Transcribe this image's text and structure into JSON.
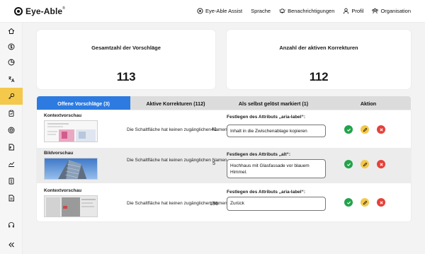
{
  "app": {
    "logo_text": "Eye-Able",
    "logo_mark": "®"
  },
  "topnav": [
    {
      "label": "Eye-Able Assist",
      "icon": "assist-icon"
    },
    {
      "label": "Sprache",
      "icon": ""
    },
    {
      "label": "Benachrichtigungen",
      "icon": "bell-icon"
    },
    {
      "label": "Profil",
      "icon": "user-icon"
    },
    {
      "label": "Organisation",
      "icon": "organisation-icon"
    }
  ],
  "sidebar": {
    "items": [
      "home-icon",
      "dollar-icon",
      "pie-chart-icon",
      "translate-icon",
      "key-icon",
      "clipboard-icon",
      "target-icon",
      "pdf-icon",
      "line-chart-icon",
      "report-icon",
      "document-icon"
    ],
    "active_index": 4,
    "bottom": [
      "support-icon",
      "collapse-icon"
    ]
  },
  "stats": {
    "suggestions_title": "Gesamtzahl der Vorschläge",
    "suggestions_value": "113",
    "corrections_title": "Anzahl der aktiven Korrekturen",
    "corrections_value": "112"
  },
  "tabs": [
    {
      "label": "Offene Vorschläge (3)",
      "active": true
    },
    {
      "label": "Aktive Korrekturen (112)",
      "active": false
    },
    {
      "label": "Als selbst gelöst markiert (1)",
      "active": false
    },
    {
      "label": "Aktion",
      "active": false
    }
  ],
  "rows": [
    {
      "preview_label": "Kontextvorschau",
      "issue": "Die Schaltfläche hat keinen zugänglichen Namen",
      "count": "41",
      "fix_label": "Festlegen des Attributs „aria-label“:",
      "fix_value": "Inhalt in die Zwischenablage kopieren"
    },
    {
      "preview_label": "Bildvorschau",
      "issue": "Die Schaltfläche hat keinen zugänglichen Namen",
      "count": "5",
      "fix_label": "Festlegen des Attributs „alt“:",
      "fix_value": "Hochhaus mit Glasfassade vor blauem Himmel."
    },
    {
      "preview_label": "Kontextvorschau",
      "issue": "Die Schaltfläche hat keinen zugänglichen Namen",
      "count": "186",
      "fix_label": "Festlegen des Attributs „aria-label“:",
      "fix_value": "Zurück"
    }
  ],
  "action_colors": {
    "accept": "#22a34a",
    "edit": "#f4c84a",
    "reject": "#e5413a"
  },
  "colors": {
    "accent": "#2d7be0",
    "sidebar_active": "#f4c84a"
  }
}
